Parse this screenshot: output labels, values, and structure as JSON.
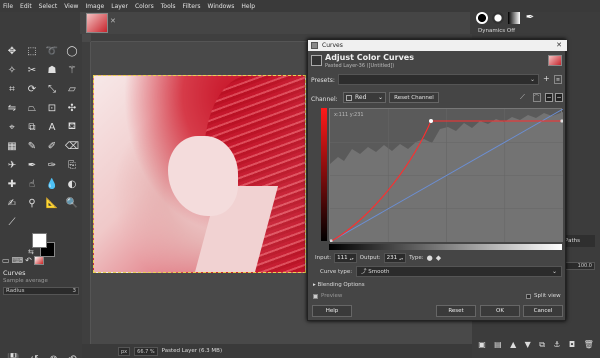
{
  "menubar": [
    "File",
    "Edit",
    "Select",
    "View",
    "Image",
    "Layer",
    "Colors",
    "Tools",
    "Filters",
    "Windows",
    "Help"
  ],
  "tool_options": {
    "title": "Curves",
    "sample_average": "Sample average",
    "radius_label": "Radius",
    "radius_value": "3"
  },
  "statusbar": {
    "unit": "px",
    "zoom": "66.7 %",
    "layer_info": "Pasted Layer (6.3 MB)"
  },
  "dock": {
    "dynamics": "Dynamics Off",
    "tab_label": "Paths",
    "value": "100.0"
  },
  "dialog": {
    "window_title": "Curves",
    "heading": "Adjust Color Curves",
    "subtitle": "Pasted Layer-36 ([Untitled])",
    "presets_label": "Presets:",
    "channel_label": "Channel:",
    "channel_value": "Red",
    "reset_channel": "Reset Channel",
    "coords_readout": "x:111 y:231",
    "input_label": "Input:",
    "input_value": "111",
    "output_label": "Output:",
    "output_value": "231",
    "type_label": "Type:",
    "curve_type_label": "Curve type:",
    "curve_type_value": "Smooth",
    "blending_options": "Blending Options",
    "preview": "Preview",
    "split_view": "Split view",
    "btn_help": "Help",
    "btn_reset": "Reset",
    "btn_ok": "OK",
    "btn_cancel": "Cancel",
    "curve_color": "#ff2d2d",
    "diagonal_color": "#6b8fd6"
  }
}
